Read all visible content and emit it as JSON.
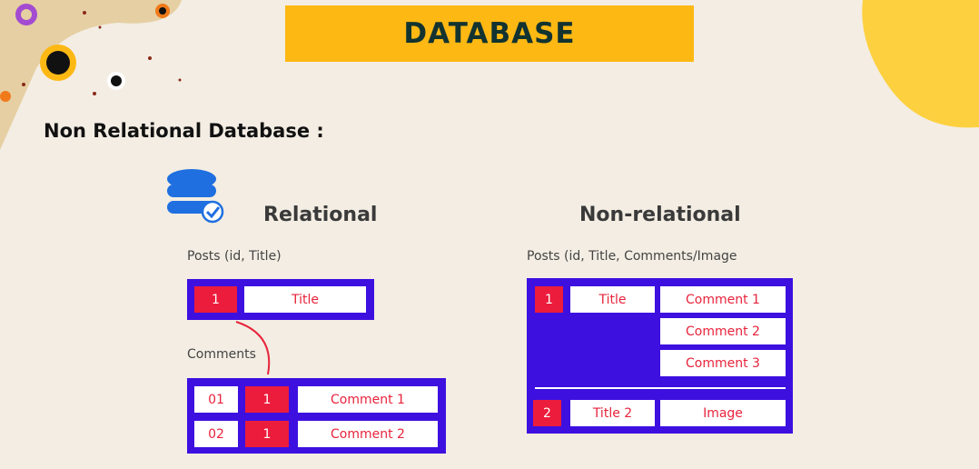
{
  "banner": {
    "title": "DATABASE"
  },
  "section_title": "Non Relational Database :",
  "colors": {
    "banner": "#fdb813",
    "frame": "#3d10e0",
    "id_cell": "#ec1c3c",
    "text_red": "#e8243c",
    "db_icon": "#1f6fe0"
  },
  "icons": {
    "database": "database-check-icon"
  },
  "relational": {
    "heading": "Relational",
    "posts_caption": "Posts (id, Title)",
    "posts_row": {
      "id": "1",
      "title": "Title"
    },
    "comments_caption": "Comments",
    "comment_rows": [
      {
        "comment_id": "01",
        "post_id": "1",
        "text": "Comment 1"
      },
      {
        "comment_id": "02",
        "post_id": "1",
        "text": "Comment 2"
      }
    ]
  },
  "nonrelational": {
    "heading": "Non-relational",
    "caption": "Posts (id, Title, Comments/Image",
    "post1": {
      "id": "1",
      "title": "Title",
      "comments": [
        "Comment 1",
        "Comment 2",
        "Comment 3"
      ]
    },
    "post2": {
      "id": "2",
      "title": "Title 2",
      "media": "Image"
    }
  }
}
